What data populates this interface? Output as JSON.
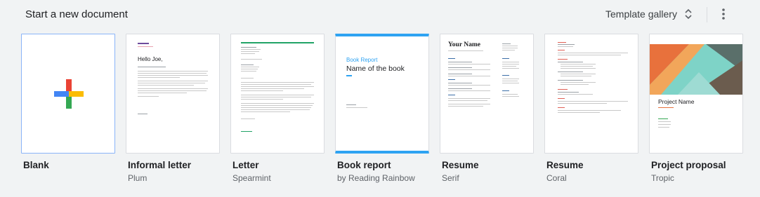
{
  "header": {
    "title": "Start a new document",
    "gallery_label": "Template gallery"
  },
  "icons": {
    "expand": "unfold-more-icon",
    "more": "more-vert-icon",
    "blank": "google-plus-icon"
  },
  "colors": {
    "blue": "#4285f4",
    "red": "#ea4335",
    "yellow": "#fbbc04",
    "green": "#34a853",
    "spearmint": "#21a366",
    "rainbow": "#2ea3f2",
    "coral": "#e06055"
  },
  "templates": [
    {
      "name": "Blank",
      "sub": ""
    },
    {
      "name": "Informal letter",
      "sub": "Plum"
    },
    {
      "name": "Letter",
      "sub": "Spearmint"
    },
    {
      "name": "Book report",
      "sub": "by Reading Rainbow"
    },
    {
      "name": "Resume",
      "sub": "Serif"
    },
    {
      "name": "Resume",
      "sub": "Coral"
    },
    {
      "name": "Project proposal",
      "sub": "Tropic"
    }
  ],
  "previews": {
    "informal": {
      "greeting": "Hello Joe,"
    },
    "book": {
      "kicker": "Book Report",
      "title": "Name of the book"
    },
    "resume_serif": {
      "name": "Your Name"
    },
    "proposal": {
      "title": "Project Name"
    }
  }
}
